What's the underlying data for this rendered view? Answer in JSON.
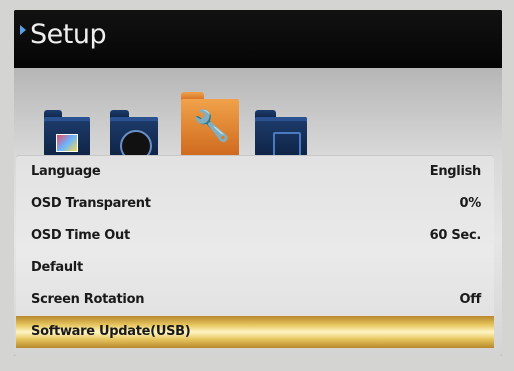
{
  "header": {
    "title": "Setup"
  },
  "icons": [
    {
      "name": "picture-folder-icon"
    },
    {
      "name": "sound-folder-icon"
    },
    {
      "name": "setup-folder-icon",
      "selected": true
    },
    {
      "name": "channel-folder-icon"
    }
  ],
  "menu": {
    "items": [
      {
        "label": "Language",
        "value": "English"
      },
      {
        "label": "OSD Transparent",
        "value": "0%"
      },
      {
        "label": "OSD Time Out",
        "value": "60 Sec."
      },
      {
        "label": "Default",
        "value": ""
      },
      {
        "label": "Screen Rotation",
        "value": "Off"
      },
      {
        "label": "Software Update(USB)",
        "value": "",
        "selected": true
      }
    ]
  },
  "colors": {
    "accent": "#5aa0e0",
    "folder": "#1d3c6c",
    "folder_selected": "#e08a30",
    "highlight": "#e7c660"
  }
}
